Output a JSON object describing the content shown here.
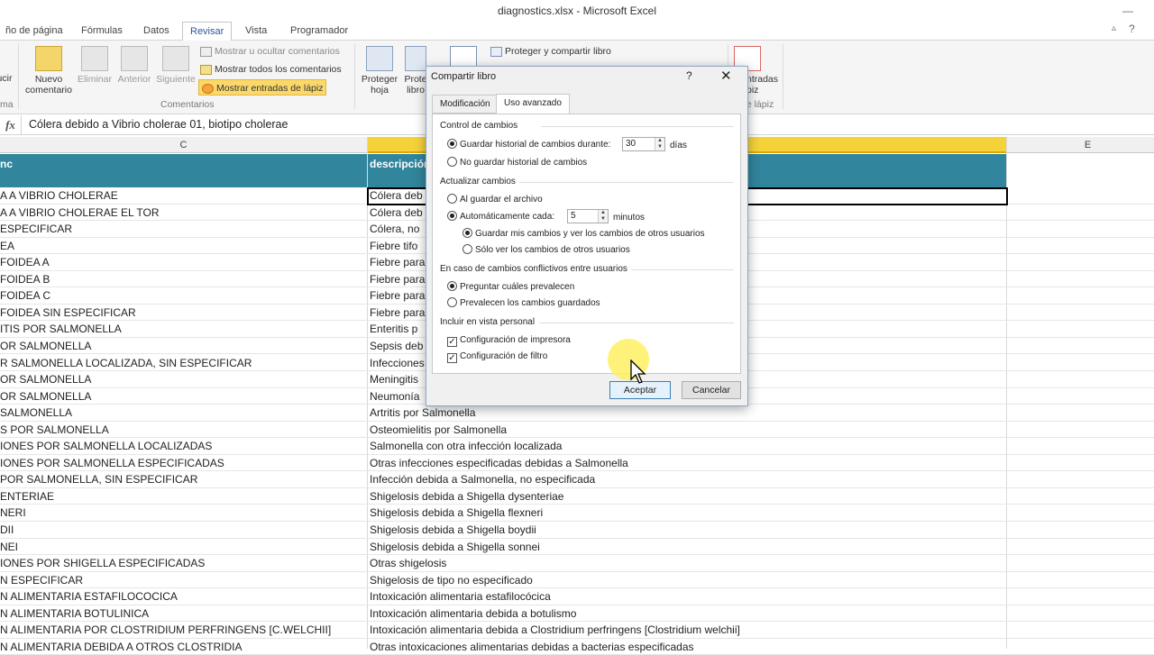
{
  "window": {
    "title": "diagnostics.xlsx - Microsoft Excel",
    "minimize": "—"
  },
  "tabs": [
    {
      "label": "ño de página"
    },
    {
      "label": "Fórmulas"
    },
    {
      "label": "Datos"
    },
    {
      "label": "Revisar"
    },
    {
      "label": "Vista"
    },
    {
      "label": "Programador"
    }
  ],
  "ribbon": {
    "partial_btn": "ucir",
    "nuevo_comentario": "Nuevo comentario",
    "eliminar": "Eliminar",
    "anterior": "Anterior",
    "siguiente": "Siguiente",
    "mostrar_ocultar": "Mostrar u ocultar comentarios",
    "mostrar_todos": "Mostrar todos los comentarios",
    "mostrar_entradas": "Mostrar entradas de lápiz",
    "comentarios_group": "Comentarios",
    "left_group_partial": "ma",
    "proteger_hoja": "Proteger hoja",
    "protect_partial": "Prote libro",
    "proteger_compartir": "Proteger y compartir libro",
    "entradas_partial": "ntradas piz",
    "lapiz_group": "de lápiz"
  },
  "formula_bar": {
    "fx": "fx",
    "value": "Cólera debido a Vibrio cholerae 01, biotipo cholerae"
  },
  "columns": {
    "c": "C",
    "e": "E"
  },
  "header_row": {
    "c": "nc",
    "d": "descripción"
  },
  "rows": [
    {
      "c": "A A VIBRIO CHOLERAE",
      "d": "Cólera deb"
    },
    {
      "c": "A A VIBRIO CHOLERAE EL TOR",
      "d": "Cólera deb"
    },
    {
      "c": "ESPECIFICAR",
      "d": "Cólera, no"
    },
    {
      "c": "EA",
      "d": "Fiebre tifo"
    },
    {
      "c": "FOIDEA A",
      "d": "Fiebre para"
    },
    {
      "c": "FOIDEA B",
      "d": "Fiebre para"
    },
    {
      "c": "FOIDEA C",
      "d": "Fiebre para"
    },
    {
      "c": "FOIDEA SIN ESPECIFICAR",
      "d": "Fiebre para"
    },
    {
      "c": "ITIS POR SALMONELLA",
      "d": "Enteritis p"
    },
    {
      "c": "OR SALMONELLA",
      "d": "Sepsis deb"
    },
    {
      "c": "R SALMONELLA LOCALIZADA, SIN ESPECIFICAR",
      "d": "Infecciones"
    },
    {
      "c": "OR SALMONELLA",
      "d": "Meningitis"
    },
    {
      "c": "OR SALMONELLA",
      "d": "Neumonía"
    },
    {
      "c": "SALMONELLA",
      "d": "Artritis por Salmonella"
    },
    {
      "c": "S POR SALMONELLA",
      "d": "Osteomielitis por Salmonella"
    },
    {
      "c": "IONES POR SALMONELLA LOCALIZADAS",
      "d": "Salmonella con otra infección localizada"
    },
    {
      "c": "IONES POR SALMONELLA ESPECIFICADAS",
      "d": "Otras infecciones especificadas debidas a Salmonella"
    },
    {
      "c": "POR SALMONELLA, SIN ESPECIFICAR",
      "d": "Infección debida a Salmonella, no especificada"
    },
    {
      "c": "ENTERIAE",
      "d": "Shigelosis debida a Shigella dysenteriae"
    },
    {
      "c": "NERI",
      "d": "Shigelosis debida a Shigella flexneri"
    },
    {
      "c": "DII",
      "d": "Shigelosis debida a Shigella boydii"
    },
    {
      "c": "NEI",
      "d": "Shigelosis debida a Shigella sonnei"
    },
    {
      "c": "IONES POR SHIGELLA ESPECIFICADAS",
      "d": "Otras shigelosis"
    },
    {
      "c": "N ESPECIFICAR",
      "d": "Shigelosis de tipo no especificado"
    },
    {
      "c": "N ALIMENTARIA ESTAFILOCOCICA",
      "d": "Intoxicación alimentaria estafilocócica"
    },
    {
      "c": "N ALIMENTARIA BOTULINICA",
      "d": "Intoxicación alimentaria debida a botulismo"
    },
    {
      "c": "N ALIMENTARIA POR CLOSTRIDIUM PERFRINGENS [C.WELCHII]",
      "d": "Intoxicación alimentaria debida a Clostridium perfringens [Clostridium welchii]"
    },
    {
      "c": "N ALIMENTARIA DEBIDA A OTROS CLOSTRIDIA",
      "d": "Otras intoxicaciones alimentarias debidas a bacterias especificadas"
    }
  ],
  "dialog": {
    "title": "Compartir libro",
    "help": "?",
    "close": "✕",
    "tab_modificacion": "Modificación",
    "tab_uso": "Uso avanzado",
    "sec_control": "Control de cambios",
    "opt_guardar_historial": "Guardar historial de cambios durante:",
    "dias_value": "30",
    "dias_label": "días",
    "opt_no_guardar": "No guardar historial de cambios",
    "sec_actualizar": "Actualizar cambios",
    "opt_al_guardar": "Al guardar el archivo",
    "opt_auto": "Automáticamente cada:",
    "minutos_value": "5",
    "minutos_label": "minutos",
    "opt_guardar_mis": "Guardar mis cambios y ver los cambios de otros usuarios",
    "opt_solo_ver": "Sólo ver los cambios de otros usuarios",
    "sec_conflictos": "En caso de cambios conflictivos entre usuarios",
    "opt_preguntar": "Preguntar cuáles prevalecen",
    "opt_prevalecen": "Prevalecen los cambios guardados",
    "sec_incluir": "Incluir en vista personal",
    "chk_impresora": "Configuración de impresora",
    "chk_filtro": "Configuración de filtro",
    "btn_aceptar": "Aceptar",
    "btn_cancelar": "Cancelar"
  },
  "colors": {
    "header_fill": "#31859c",
    "accent": "#2b579a"
  }
}
